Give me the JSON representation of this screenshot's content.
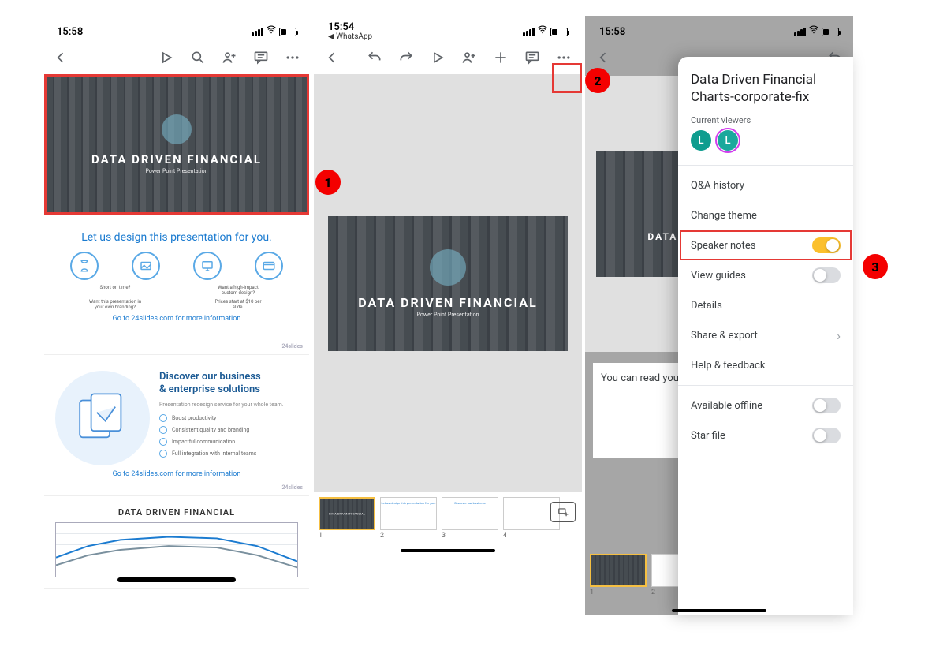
{
  "status": {
    "time1": "15:58",
    "time2": "15:54",
    "time3": "15:58",
    "whatsapp": "◀ WhatsApp"
  },
  "toolbar": {
    "back": "Back",
    "play": "Play",
    "search": "Search",
    "addperson": "Share",
    "comment": "Comment",
    "more": "More",
    "undo": "Undo",
    "redo": "Redo",
    "add": "Add"
  },
  "slides": {
    "main": {
      "title": "DATA DRIVEN FINANCIAL",
      "subtitle": "Power Point Presentation"
    },
    "design": {
      "heading": "Let us design this presentation for you.",
      "c1": "Short on time?",
      "c2": "Want a high-impact custom design?",
      "c3": "Want this presentation in your own branding?",
      "c4": "Prices start at $10 per slide.",
      "footer": "Go to 24slides.com for more information",
      "brand": "24slides"
    },
    "solutions": {
      "heading1": "Discover our business",
      "heading2": "& enterprise solutions",
      "sub": "Presentation redesign service for your whole team.",
      "b1": "Boost productivity",
      "b2": "Consistent quality and branding",
      "b3": "Impactful communication",
      "b4": "Full integration with internal teams",
      "footer": "Go to 24slides.com for more information",
      "brand": "24slides"
    },
    "chart": {
      "title": "DATA DRIVEN FINANCIAL"
    }
  },
  "thumbs": {
    "n1": "1",
    "n2": "2",
    "n3": "3",
    "n4": "4"
  },
  "notes_hint": "You can read your sp",
  "panel": {
    "title": "Data Driven Financial Charts-corporate-fix",
    "viewers_label": "Current viewers",
    "avatar_L": "L",
    "qa": "Q&A history",
    "theme": "Change theme",
    "speaker": "Speaker notes",
    "guides": "View guides",
    "details": "Details",
    "share": "Share & export",
    "help": "Help & feedback",
    "offline": "Available offline",
    "star": "Star file"
  },
  "badges": {
    "b1": "1",
    "b2": "2",
    "b3": "3"
  }
}
